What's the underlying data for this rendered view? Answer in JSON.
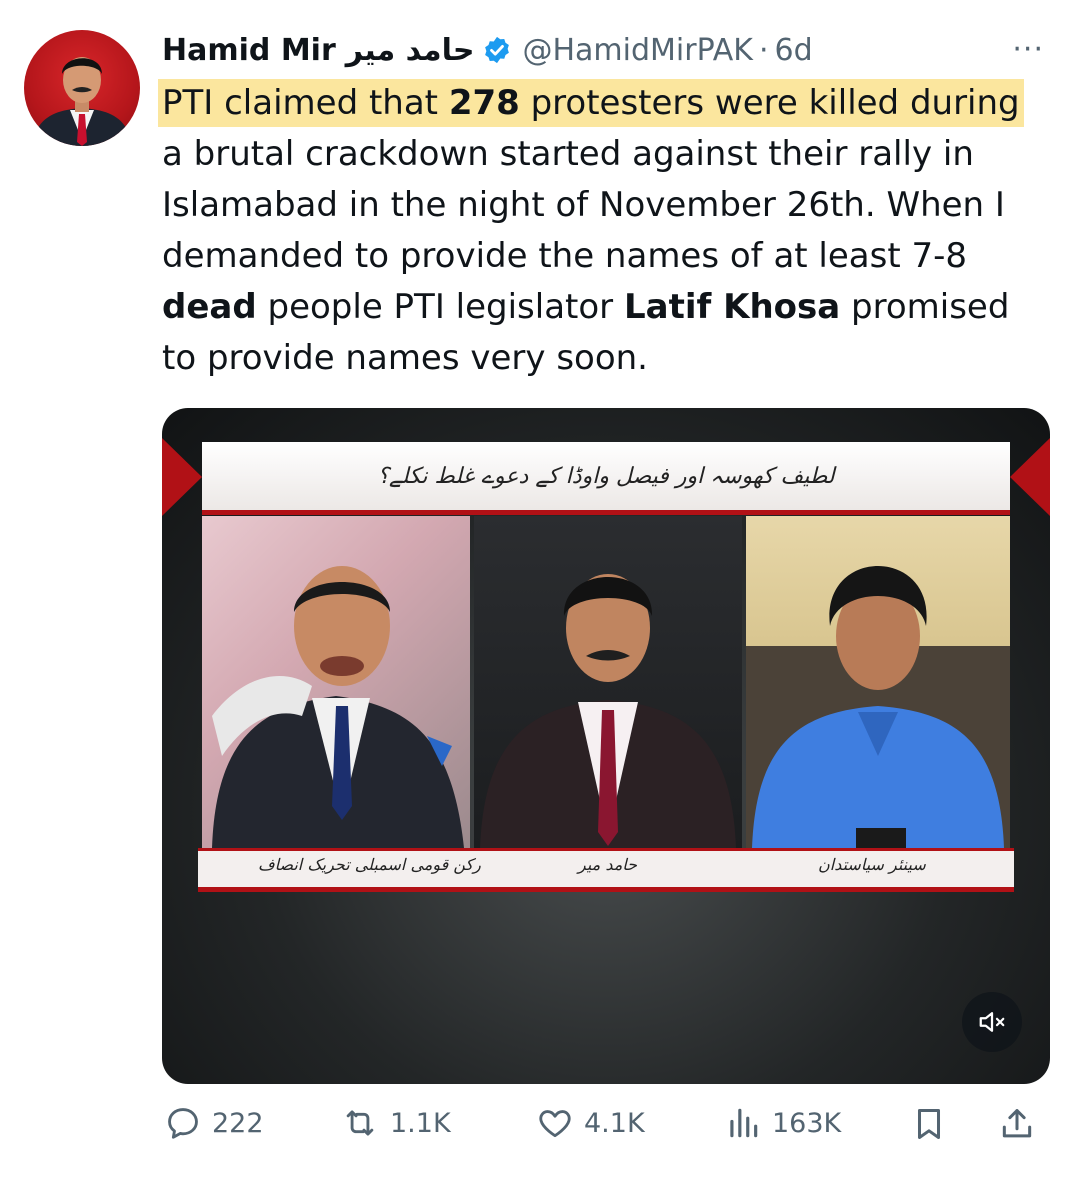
{
  "tweet": {
    "author_name": "Hamid Mir",
    "author_name_urdu": "حامد میر",
    "handle": "@HamidMirPAK",
    "time_ago": "6d",
    "separator": "·",
    "more_label": "···",
    "text": {
      "line1_a": "PTI claimed that ",
      "line1_b": "278",
      "line1_c": " protesters were killed during",
      "line2": "a brutal crackdown started against their rally in",
      "line3": "Islamabad in the night of November 26th. When I",
      "line4": "demanded to provide the names of at least 7-8",
      "line5_a": "dead",
      "line5_b": " people PTI legislator ",
      "line5_c": "Latif Khosa",
      "line5_d": " promised",
      "line6": "to provide names very soon."
    }
  },
  "video": {
    "headline_urdu": "لطیف کھوسہ اور فیصل واوڈا کے دعوے غلط نکلے؟",
    "caption_left": "رکن قومی اسمبلی تحریک انصاف",
    "caption_center": "حامد میر",
    "caption_right": "سینئر سیاستدان",
    "muted": true
  },
  "actions": {
    "replies": "222",
    "reposts": "1.1K",
    "likes": "4.1K",
    "views": "163K"
  },
  "colors": {
    "highlight": "#fbe69e",
    "verified": "#1d9bf0",
    "muted_text": "#536471",
    "channel_red": "#b11116"
  },
  "icons": [
    "verified-badge-icon",
    "more-icon",
    "mute-icon",
    "reply-icon",
    "repost-icon",
    "like-icon",
    "views-icon",
    "bookmark-icon",
    "share-icon"
  ]
}
